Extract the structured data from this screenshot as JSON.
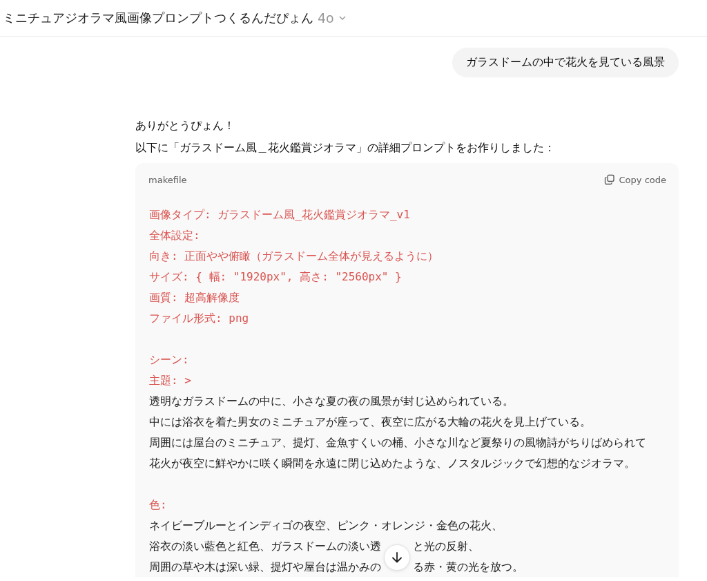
{
  "header": {
    "title": "ミニチュアジオラマ風画像プロンプトつくるんだぴょん",
    "model": "4o"
  },
  "user_message": "ガラスドームの中で花火を見ている風景",
  "assistant": {
    "paragraphs": [
      "ありがとうぴょん！",
      "以下に「ガラスドーム風＿花火鑑賞ジオラマ」の詳細プロンプトをお作りしました："
    ],
    "code_block": {
      "language": "makefile",
      "copy_label": "Copy code",
      "lines": [
        {
          "kind": "key",
          "text": "画像タイプ: ガラスドーム風_花火鑑賞ジオラマ_v1"
        },
        {
          "kind": "key",
          "text": "全体設定:"
        },
        {
          "kind": "key",
          "text": "向き: 正面やや俯瞰（ガラスドーム全体が見えるように）"
        },
        {
          "kind": "key",
          "text": "サイズ: { 幅: \"1920px\", 高さ: \"2560px\" }"
        },
        {
          "kind": "key",
          "text": "画質: 超高解像度"
        },
        {
          "kind": "key",
          "text": "ファイル形式: png"
        },
        {
          "kind": "blank"
        },
        {
          "kind": "key",
          "text": "シーン:"
        },
        {
          "kind": "key",
          "text": "主題: >"
        },
        {
          "kind": "plain",
          "text": "透明なガラスドームの中に、小さな夏の夜の風景が封じ込められている。"
        },
        {
          "kind": "plain",
          "text": "中には浴衣を着た男女のミニチュアが座って、夜空に広がる大輪の花火を見上げている。"
        },
        {
          "kind": "plain",
          "text": "周囲には屋台のミニチュア、提灯、金魚すくいの桶、小さな川など夏祭りの風物詩がちりばめられて"
        },
        {
          "kind": "plain",
          "text": "花火が夜空に鮮やかに咲く瞬間を永遠に閉じ込めたような、ノスタルジックで幻想的なジオラマ。"
        },
        {
          "kind": "blank"
        },
        {
          "kind": "key",
          "text": "色:"
        },
        {
          "kind": "plain",
          "text": "ネイビーブルーとインディゴの夜空、ピンク・オレンジ・金色の花火、"
        },
        {
          "kind": "split",
          "segments": [
            "浴衣の淡い藍色と紅色、ガラスドームの淡い透",
            "と光の反射、"
          ]
        },
        {
          "kind": "split",
          "segments": [
            "周囲の草や木は深い緑、提灯や屋台は温かみの",
            "る赤・黄の光を放つ。"
          ]
        }
      ]
    }
  }
}
